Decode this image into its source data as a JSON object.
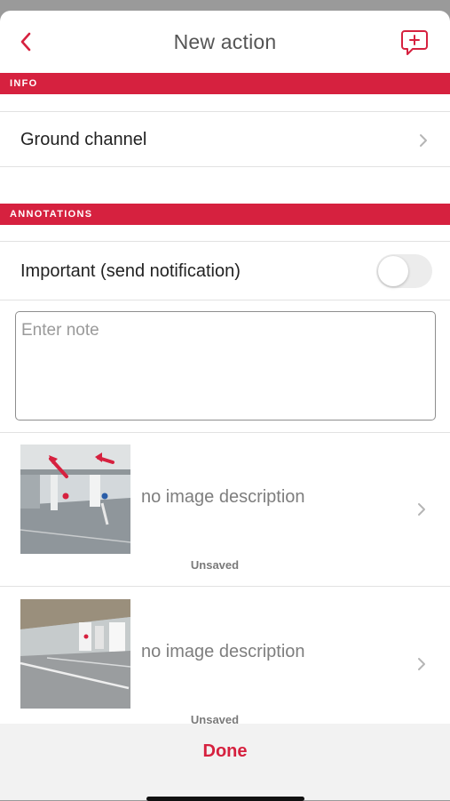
{
  "header": {
    "title": "New action",
    "back_icon": "chevron-left-icon",
    "action_icon": "add-comment-icon",
    "accent_color": "#d6213f"
  },
  "info_section": {
    "header": "INFO",
    "items": [
      {
        "label": "Ground channel"
      }
    ]
  },
  "annotations_section": {
    "header": "ANNOTATIONS",
    "important": {
      "label": "Important (send notification)",
      "enabled": false
    },
    "note": {
      "placeholder": "Enter note",
      "value": ""
    },
    "attachments": [
      {
        "description": "no image description",
        "status": "Unsaved"
      },
      {
        "description": "no image description",
        "status": "Unsaved"
      }
    ]
  },
  "footer": {
    "done_label": "Done"
  }
}
